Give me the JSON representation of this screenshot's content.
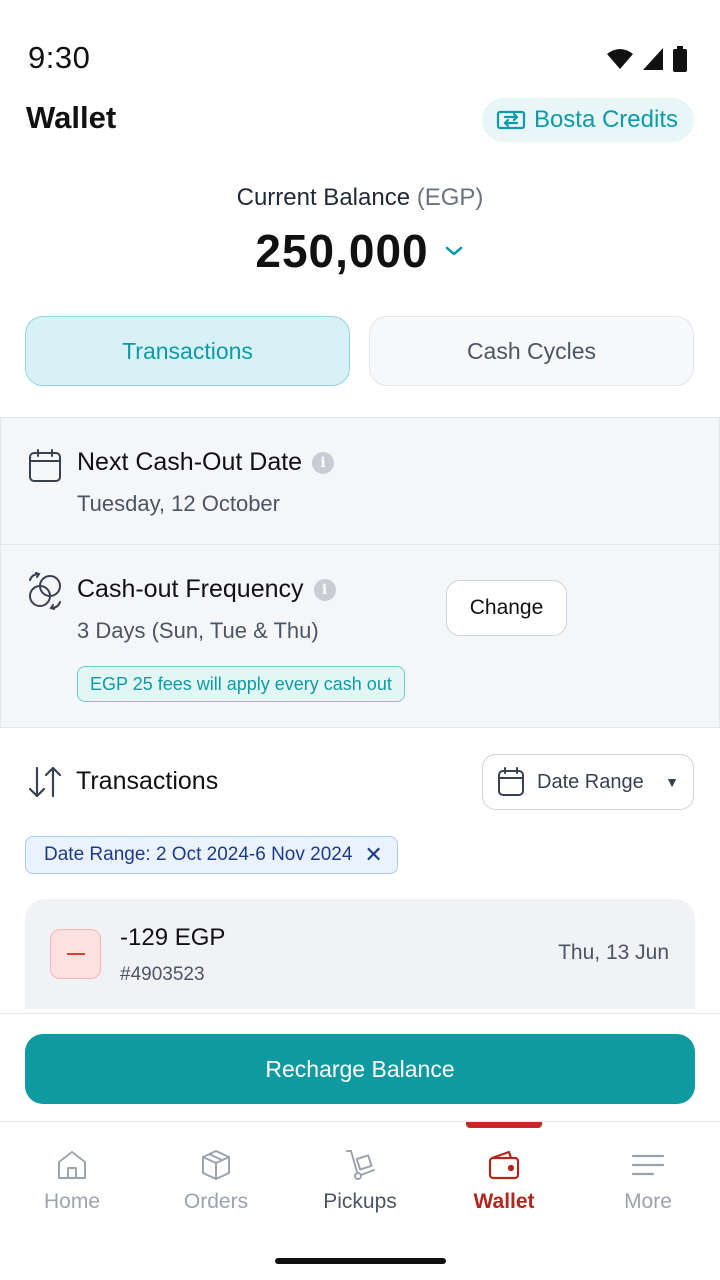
{
  "status_bar": {
    "time": "9:30"
  },
  "header": {
    "title": "Wallet",
    "credits_label": "Bosta Credits"
  },
  "balance": {
    "label": "Current Balance",
    "unit": "(EGP)",
    "amount": "250,000"
  },
  "tabs": [
    {
      "label": "Transactions",
      "active": true
    },
    {
      "label": "Cash Cycles",
      "active": false
    }
  ],
  "cashout": {
    "next_title": "Next Cash-Out Date",
    "next_date": "Tuesday, 12 October",
    "frequency_title": "Cash-out Frequency",
    "frequency_value": "3 Days (Sun, Tue & Thu)",
    "fee_note": "EGP 25 fees will apply every cash out",
    "change_label": "Change"
  },
  "transactions": {
    "title": "Transactions",
    "date_range_button": "Date Range",
    "filter_chip": "Date Range: 2 Oct 2024-6 Nov 2024",
    "items": [
      {
        "amount": "-129 EGP",
        "ref": "#4903523",
        "date": "Thu, 13 Jun"
      }
    ]
  },
  "actions": {
    "recharge_label": "Recharge Balance"
  },
  "nav": {
    "items": [
      {
        "label": "Home"
      },
      {
        "label": "Orders"
      },
      {
        "label": "Pickups"
      },
      {
        "label": "Wallet"
      },
      {
        "label": "More"
      }
    ]
  },
  "colors": {
    "accent": "#0f9aa2",
    "active_nav": "#b3261e",
    "negative": "#e53935"
  }
}
